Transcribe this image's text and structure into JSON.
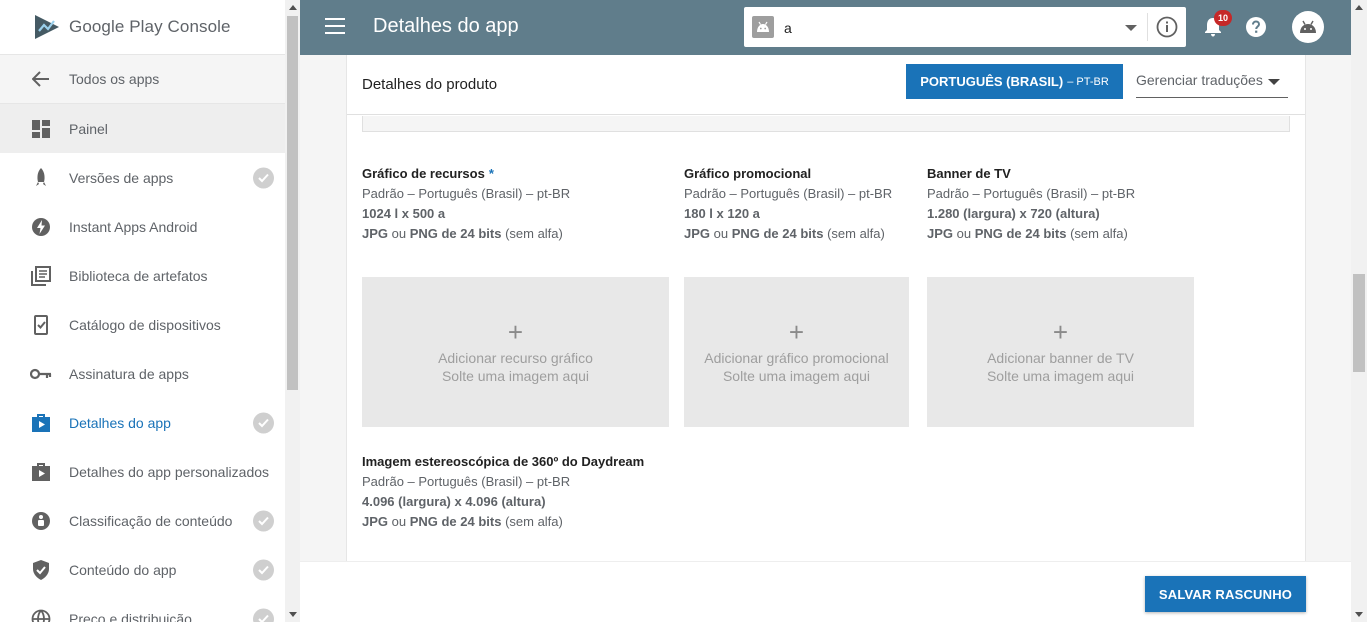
{
  "brand": {
    "logo_text": "Google Play Console",
    "primary_color": "#607d8b",
    "accent_color": "#1a73b8"
  },
  "header": {
    "title": "Detalhes do app",
    "app_selector": {
      "value": "a"
    },
    "notifications_count": "10"
  },
  "sidebar": {
    "back_label": "Todos os apps",
    "painel_label": "Painel",
    "items": [
      {
        "label": "Versões de apps",
        "icon": "rocket-icon",
        "checked": true
      },
      {
        "label": "Instant Apps Android",
        "icon": "bolt-icon",
        "checked": false
      },
      {
        "label": "Biblioteca de artefatos",
        "icon": "library-icon",
        "checked": false
      },
      {
        "label": "Catálogo de dispositivos",
        "icon": "device-catalog-icon",
        "checked": false
      },
      {
        "label": "Assinatura de apps",
        "icon": "key-icon",
        "checked": false
      },
      {
        "label": "Detalhes do app",
        "icon": "store-listing-icon",
        "checked": true,
        "active": true
      },
      {
        "label": "Detalhes do app personalizados",
        "icon": "custom-listing-icon",
        "checked": false
      },
      {
        "label": "Classificação de conteúdo",
        "icon": "content-rating-icon",
        "checked": true
      },
      {
        "label": "Conteúdo do app",
        "icon": "shield-icon",
        "checked": true
      },
      {
        "label": "Preço e distribuição",
        "icon": "globe-icon",
        "checked": true
      }
    ]
  },
  "card": {
    "title": "Detalhes do produto",
    "language_button": {
      "label": "PORTUGUÊS (BRASIL)",
      "code": "– PT-BR"
    },
    "translations_select": "Gerenciar traduções"
  },
  "assets": [
    {
      "title": "Gráfico de recursos",
      "required": "*",
      "default_lang": "Padrão – Português (Brasil) – pt-BR",
      "dims": "1024 l x 500 a",
      "fmt_a": "JPG",
      "fmt_or": " ou ",
      "fmt_b": "PNG de 24 bits",
      "fmt_tail": " (sem alfa)",
      "drop_line1": "Adicionar recurso gráfico",
      "drop_line2": "Solte uma imagem aqui"
    },
    {
      "title": "Gráfico promocional",
      "default_lang": "Padrão – Português (Brasil) – pt-BR",
      "dims": "180 l x 120 a",
      "fmt_a": "JPG",
      "fmt_or": " ou ",
      "fmt_b": "PNG de 24 bits",
      "fmt_tail": " (sem alfa)",
      "drop_line1": "Adicionar gráfico promocional",
      "drop_line2": "Solte uma imagem aqui"
    },
    {
      "title": "Banner de TV",
      "default_lang": "Padrão – Português (Brasil) – pt-BR",
      "dims": "1.280 (largura) x 720 (altura)",
      "fmt_a": "JPG",
      "fmt_or": " ou ",
      "fmt_b": "PNG de 24 bits",
      "fmt_tail": " (sem alfa)",
      "drop_line1": "Adicionar banner de TV",
      "drop_line2": "Solte uma imagem aqui"
    },
    {
      "title": "Imagem estereoscópica de 360º do Daydream",
      "default_lang": "Padrão – Português (Brasil) – pt-BR",
      "dims": "4.096 (largura) x 4.096 (altura)",
      "fmt_a": "JPG",
      "fmt_or": " ou ",
      "fmt_b": "PNG de 24 bits",
      "fmt_tail": " (sem alfa)"
    }
  ],
  "dropzone_plus": "+",
  "footer": {
    "save_label": "SALVAR RASCUNHO"
  }
}
